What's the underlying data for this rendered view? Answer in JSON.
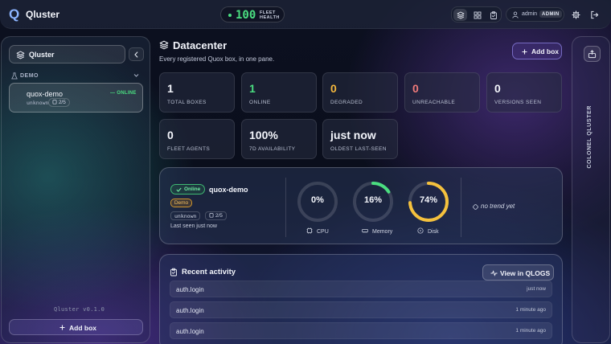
{
  "app": {
    "logo": "Q",
    "title": "Qluster"
  },
  "header": {
    "fleet_health_value": "100",
    "fleet_health_label_1": "FLEET",
    "fleet_health_label_2": "HEALTH",
    "nav_icons": [
      "layers-icon",
      "grid-icon",
      "clipboard-icon"
    ],
    "user_name": "admin",
    "user_role": "ADMIN"
  },
  "sidebar": {
    "section_title": "Qluster",
    "group_label": "DEMO",
    "items": [
      {
        "name": "quox-demo",
        "status": "— ONLINE",
        "meta": "unknown",
        "count": "2/5"
      }
    ],
    "version": "Qluster v0.1.0",
    "add_label": "Add box"
  },
  "main": {
    "title": "Datacenter",
    "subtitle": "Every registered Quox box, in one pane.",
    "add_label": "Add box",
    "stats": [
      {
        "value": "1",
        "label": "TOTAL BOXES",
        "color": "#f3f5fb"
      },
      {
        "value": "1",
        "label": "ONLINE",
        "color": "#4ade80"
      },
      {
        "value": "0",
        "label": "DEGRADED",
        "color": "#f5b83d"
      },
      {
        "value": "0",
        "label": "UNREACHABLE",
        "color": "#f07a7a"
      },
      {
        "value": "0",
        "label": "VERSIONS SEEN",
        "color": "#f3f5fb"
      },
      {
        "value": "0",
        "label": "FLEET AGENTS",
        "color": "#f3f5fb"
      },
      {
        "value": "100%",
        "label": "7D AVAILABILITY",
        "color": "#f3f5fb"
      },
      {
        "value": "just now",
        "label": "OLDEST LAST-SEEN",
        "color": "#f3f5fb"
      }
    ]
  },
  "box_card": {
    "status": "Online",
    "name": "quox-demo",
    "tag": "Demo",
    "meta": "unknown",
    "count": "2/5",
    "last_seen": "Last seen just now",
    "gauges": [
      {
        "label": "CPU",
        "value_text": "0%",
        "fraction": 0.0,
        "color": "#4ade80",
        "icon": "cpu-icon"
      },
      {
        "label": "Memory",
        "value_text": "16%",
        "fraction": 0.16,
        "color": "#4ade80",
        "icon": "memory-icon"
      },
      {
        "label": "Disk",
        "value_text": "74%",
        "fraction": 0.74,
        "color": "#f5c13d",
        "icon": "disk-icon"
      }
    ],
    "trend": "no trend yet"
  },
  "activity": {
    "title": "Recent activity",
    "view_label": "View in QLOGS",
    "rows": [
      {
        "event": "auth.login",
        "time": "just now"
      },
      {
        "event": "auth.login",
        "time": "1 minute ago"
      },
      {
        "event": "auth.login",
        "time": "1 minute ago"
      }
    ]
  },
  "rail": {
    "label": "COLONEL QLUSTER"
  }
}
